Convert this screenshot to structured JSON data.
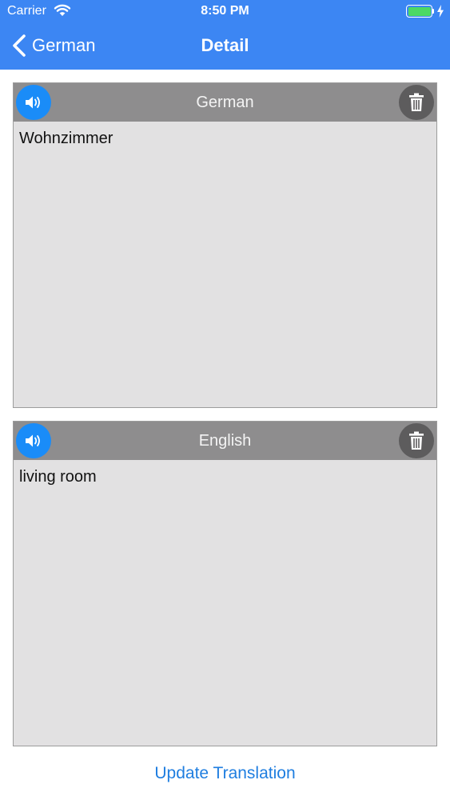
{
  "status_bar": {
    "carrier": "Carrier",
    "time": "8:50 PM",
    "battery_level": 1.0
  },
  "nav": {
    "back_label": "German",
    "title": "Detail"
  },
  "cards": [
    {
      "language": "German",
      "text": "Wohnzimmer"
    },
    {
      "language": "English",
      "text": "living room"
    }
  ],
  "update_button": "Update Translation",
  "icons": {
    "back": "chevron-left-icon",
    "speak": "speaker-icon",
    "delete": "trash-icon",
    "wifi": "wifi-icon",
    "battery": "battery-icon",
    "charging": "bolt-icon"
  },
  "colors": {
    "nav_bar": "#3c86f3",
    "speak_button": "#1a8cf8",
    "trash_button": "#5d5c5d",
    "card_header": "#8e8d8e",
    "card_body": "#e2e1e2",
    "link": "#1f7ee0",
    "battery_fill": "#4cd964"
  }
}
